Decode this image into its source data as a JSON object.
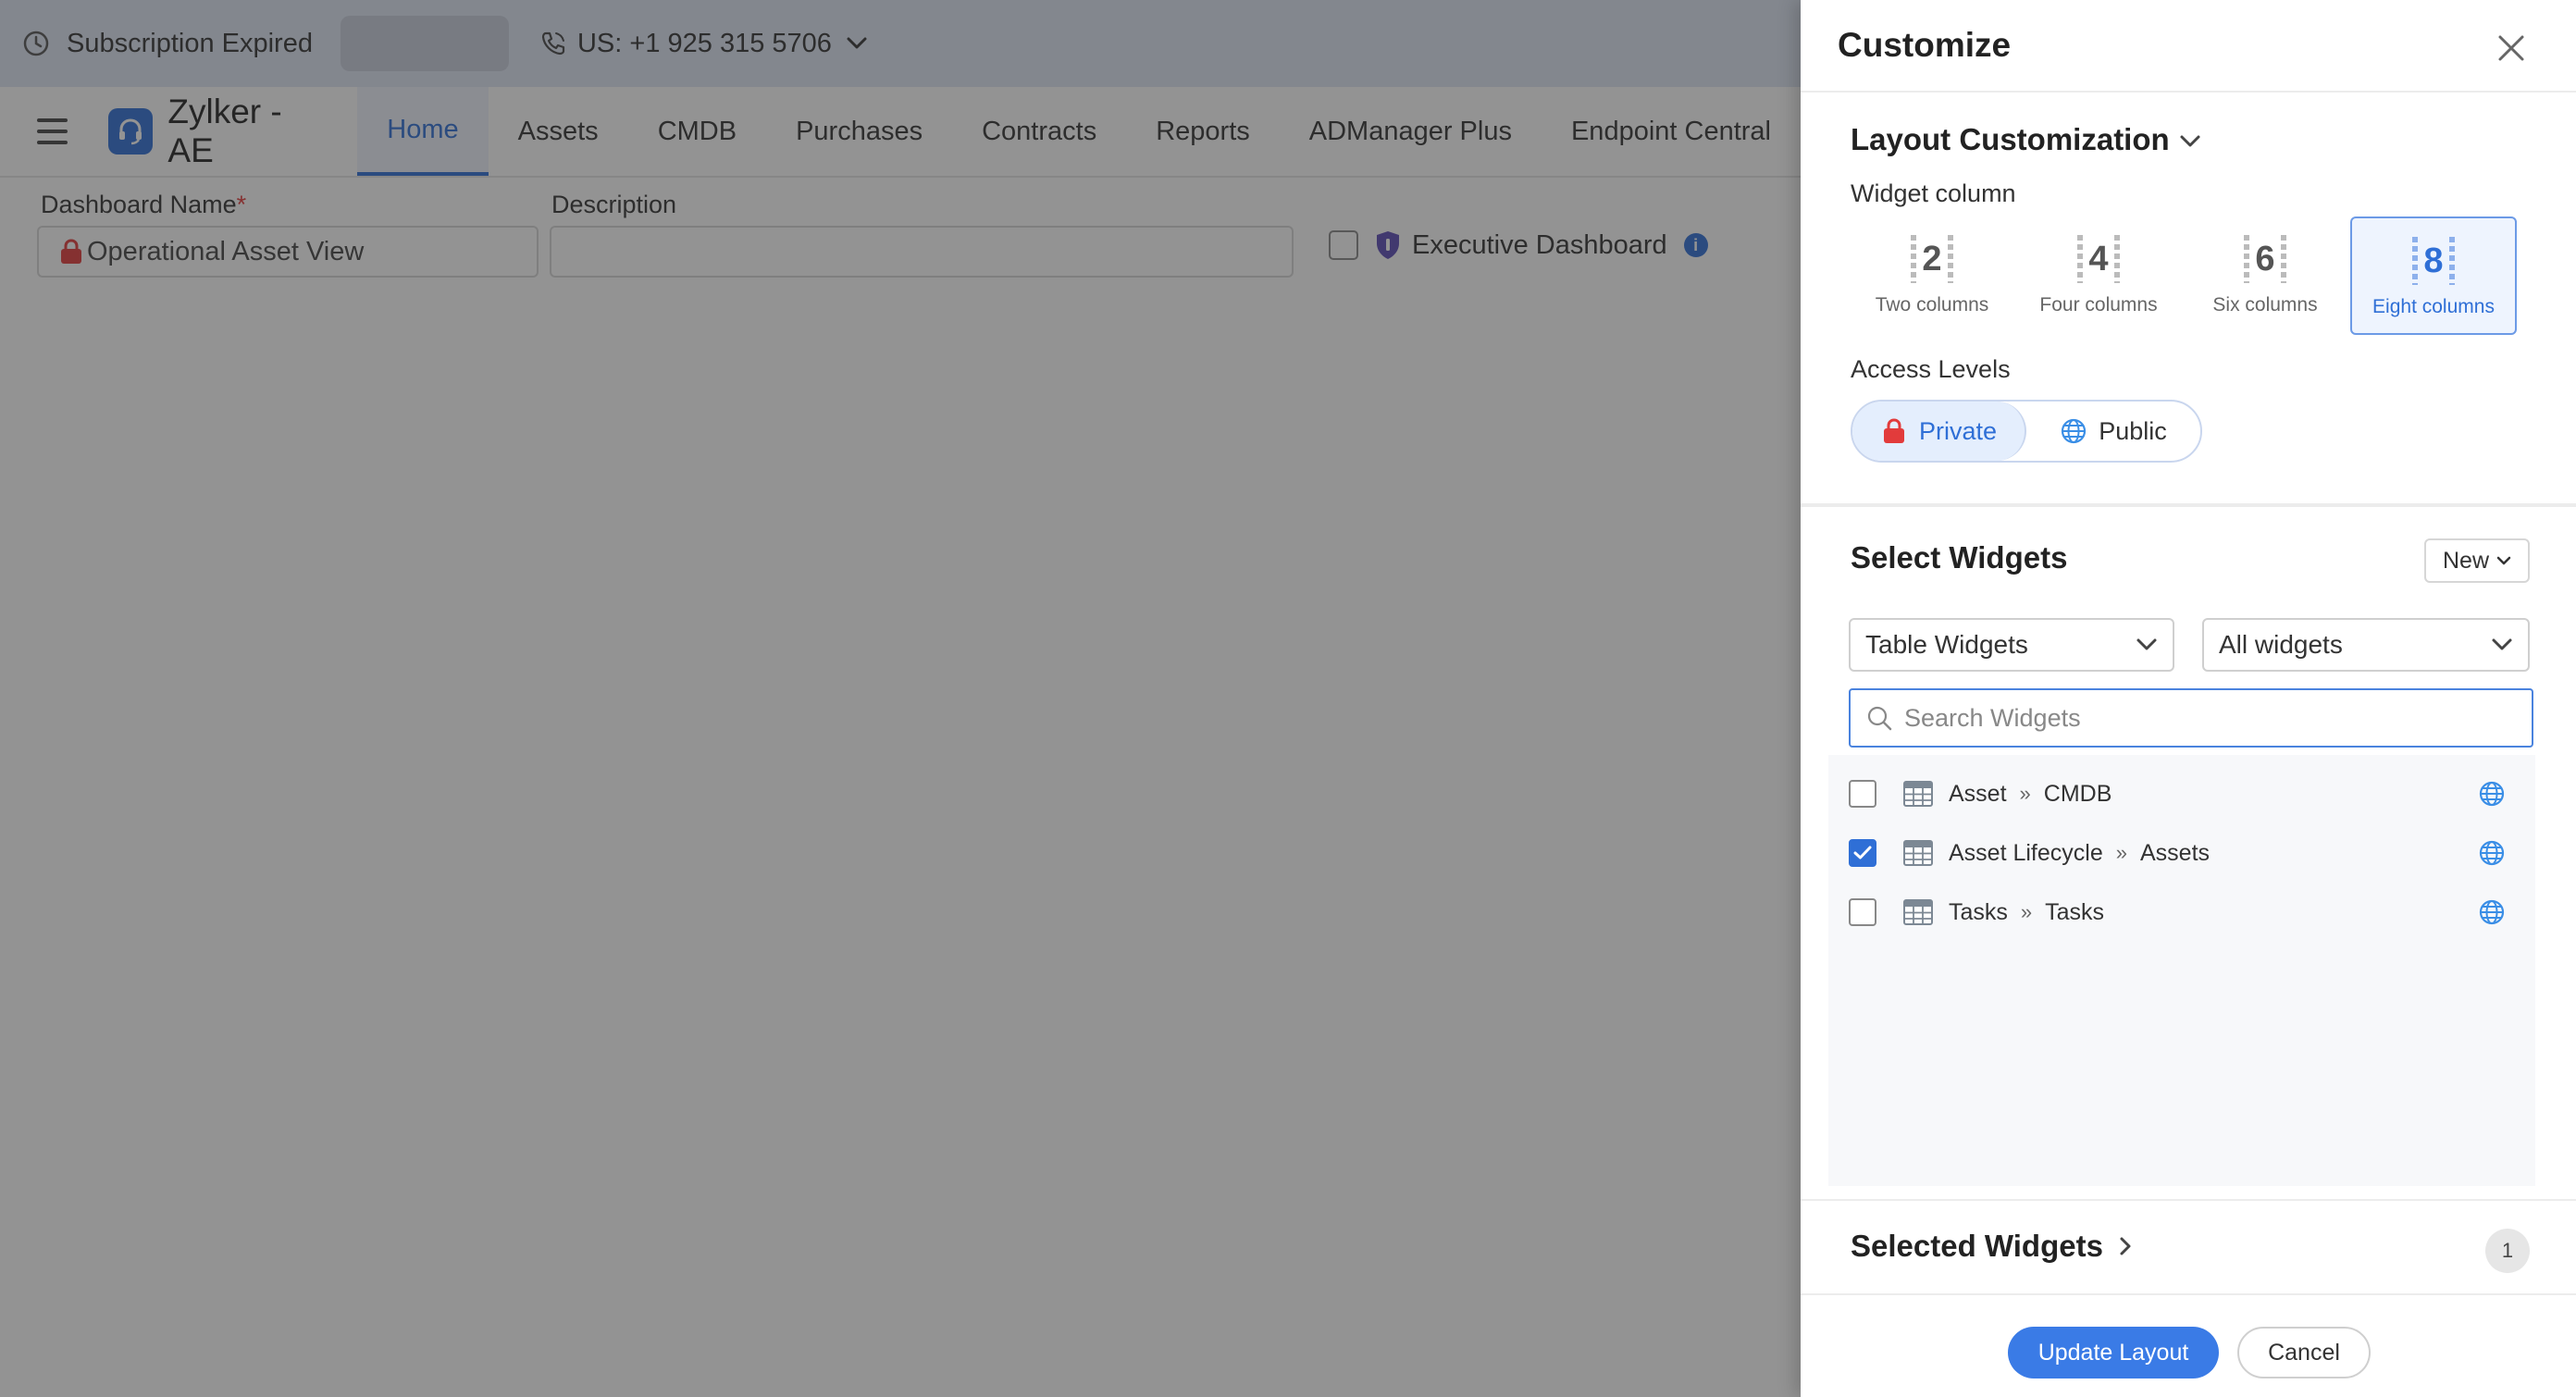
{
  "topbar": {
    "subscription_text": "Subscription Expired",
    "phone_text": "US: +1 925 315 5706"
  },
  "navbar": {
    "brand_name": "Zylker - AE",
    "tabs": [
      {
        "label": "Home",
        "active": true
      },
      {
        "label": "Assets"
      },
      {
        "label": "CMDB"
      },
      {
        "label": "Purchases"
      },
      {
        "label": "Contracts"
      },
      {
        "label": "Reports"
      },
      {
        "label": "ADManager Plus"
      },
      {
        "label": "Endpoint Central"
      }
    ]
  },
  "form": {
    "dashboard_name_label": "Dashboard Name",
    "required_mark": "*",
    "dashboard_name_value": "Operational Asset View",
    "description_label": "Description",
    "description_value": "",
    "executive_label": "Executive Dashboard"
  },
  "panel": {
    "title": "Customize",
    "layout_title": "Layout Customization",
    "widget_column_label": "Widget column",
    "column_options": [
      {
        "number": "2",
        "label": "Two columns"
      },
      {
        "number": "4",
        "label": "Four columns"
      },
      {
        "number": "6",
        "label": "Six columns"
      },
      {
        "number": "8",
        "label": "Eight columns",
        "selected": true
      }
    ],
    "access_levels_label": "Access Levels",
    "access_private": "Private",
    "access_public": "Public",
    "select_widgets_title": "Select Widgets",
    "new_button": "New",
    "widget_type_select": "Table Widgets",
    "widget_filter_select": "All widgets",
    "search_placeholder": "Search Widgets",
    "widgets": [
      {
        "name": "Asset",
        "category": "CMDB",
        "checked": false
      },
      {
        "name": "Asset Lifecycle",
        "category": "Assets",
        "checked": true
      },
      {
        "name": "Tasks",
        "category": "Tasks",
        "checked": false
      }
    ],
    "widget_separator": "»",
    "selected_widgets_title": "Selected Widgets",
    "selected_count": "1",
    "update_button": "Update Layout",
    "cancel_button": "Cancel"
  },
  "colors": {
    "accent": "#2f6fd6",
    "update_button": "#3a7be6",
    "topbar_bg": "#dfe6f5",
    "lock_red": "#e23b3b"
  }
}
